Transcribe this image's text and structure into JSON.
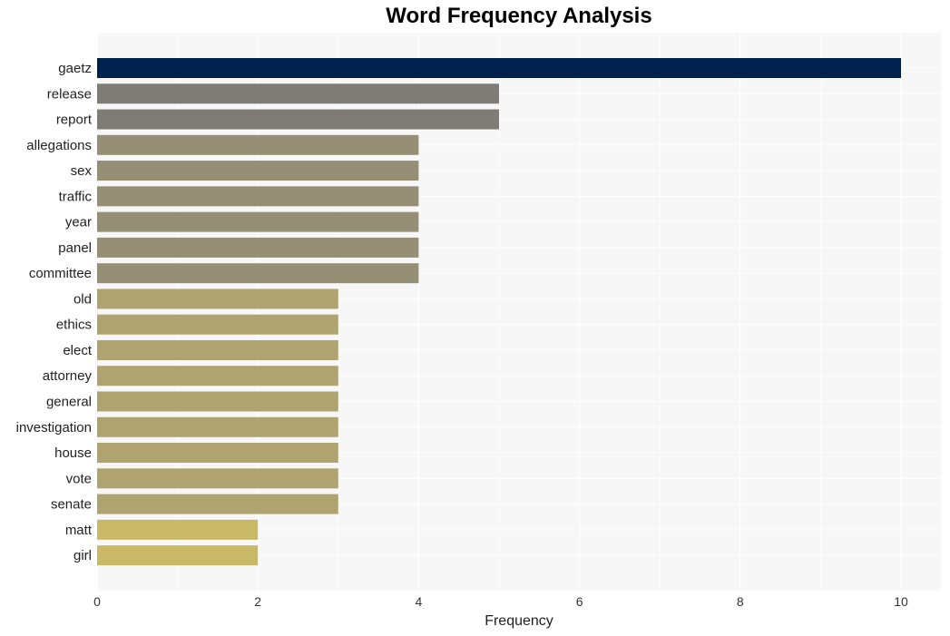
{
  "chart_data": {
    "type": "bar",
    "orientation": "horizontal",
    "title": "Word Frequency Analysis",
    "xlabel": "Frequency",
    "ylabel": "",
    "xlim": [
      0,
      10.5
    ],
    "xticks": [
      0,
      2,
      4,
      6,
      8,
      10
    ],
    "grid": true,
    "categories": [
      "gaetz",
      "release",
      "report",
      "allegations",
      "sex",
      "traffic",
      "year",
      "panel",
      "committee",
      "old",
      "ethics",
      "elect",
      "attorney",
      "general",
      "investigation",
      "house",
      "vote",
      "senate",
      "matt",
      "girl"
    ],
    "values": [
      10,
      5,
      5,
      4,
      4,
      4,
      4,
      4,
      4,
      3,
      3,
      3,
      3,
      3,
      3,
      3,
      3,
      3,
      2,
      2
    ],
    "colors": {
      "10": "#00214d",
      "5": "#7f7c75",
      "4": "#958f76",
      "3": "#afa370",
      "2": "#c9b866"
    },
    "plot_background": "#f7f7f7",
    "grid_color": "#ffffff"
  }
}
